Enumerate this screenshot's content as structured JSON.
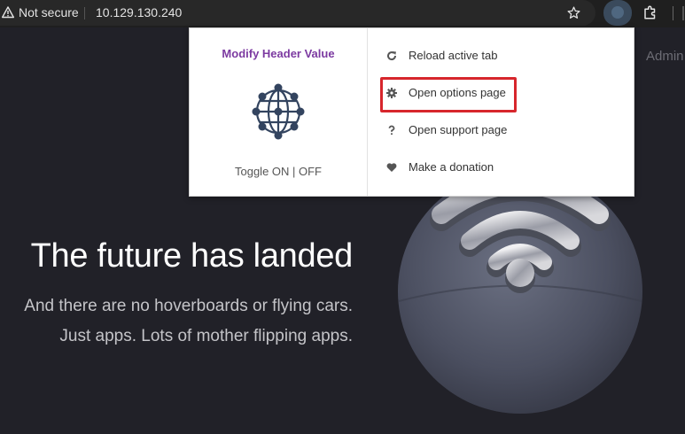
{
  "browser": {
    "security_label": "Not secure",
    "url": "10.129.130.240"
  },
  "page": {
    "nav_admin": "Admin",
    "hero_title": "The future has landed",
    "hero_sub1": "And there are no hoverboards or flying cars.",
    "hero_sub2": "Just apps. Lots of mother flipping apps."
  },
  "popup": {
    "title": "Modify Header Value",
    "toggle": "Toggle ON | OFF",
    "menu": [
      {
        "label": "Reload active tab",
        "icon": "refresh-icon"
      },
      {
        "label": "Open options page",
        "icon": "gear-icon"
      },
      {
        "label": "Open support page",
        "icon": "question-icon"
      },
      {
        "label": "Make a donation",
        "icon": "heart-icon"
      }
    ]
  },
  "colors": {
    "popup_title": "#7c3aa1",
    "highlight": "#d7262c",
    "page_bg": "#212128"
  }
}
